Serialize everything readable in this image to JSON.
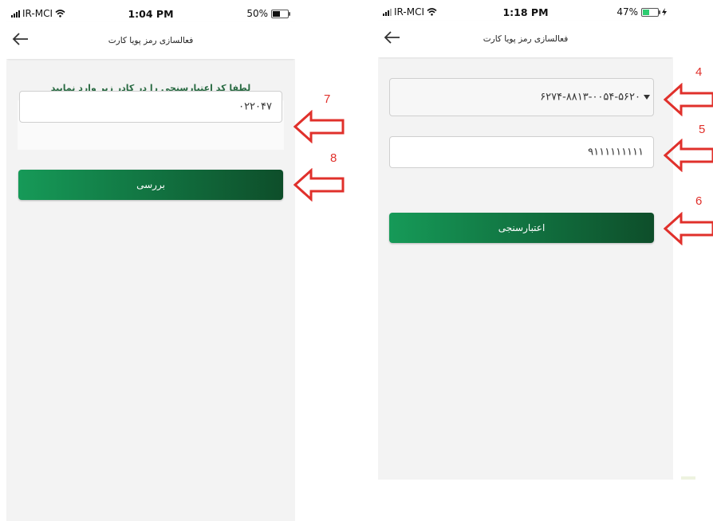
{
  "left_screen": {
    "status": {
      "carrier": "IR-MCI",
      "time": "1:04 PM",
      "battery": "50%",
      "battery_level": 0.5
    },
    "nav_title": "فعالسازی رمز پویا کارت",
    "prompt": "لطفا کد اعتبارسنجی را در کادر زیر وارد نمایید",
    "code_value": "۰۲۲۰۴۷",
    "submit_label": "بررسی"
  },
  "right_screen": {
    "status": {
      "carrier": "IR-MCI",
      "time": "1:18 PM",
      "battery": "47%",
      "battery_level": 0.47
    },
    "nav_title": "فعالسازی رمز پویا کارت",
    "card_number": "۶۲۷۴-۸۸۱۳-۰۰۵۴-۵۶۲۰",
    "phone_value": "۹۱۱۱۱۱۱۱۱۱",
    "submit_label": "اعتبارسنجی"
  },
  "callouts": {
    "c4": "4",
    "c5": "5",
    "c6": "6",
    "c7": "7",
    "c8": "8"
  },
  "colors": {
    "accent_green": "#169a58",
    "accent_dark": "#0e4e2a",
    "battery_green": "#2ecc71",
    "callout_red": "#e0302b"
  },
  "icons": [
    "back-arrow-icon",
    "wifi-icon",
    "signal-icon",
    "battery-icon",
    "dropdown-caret-icon",
    "annotation-arrow-icon",
    "charging-bolt-icon"
  ]
}
